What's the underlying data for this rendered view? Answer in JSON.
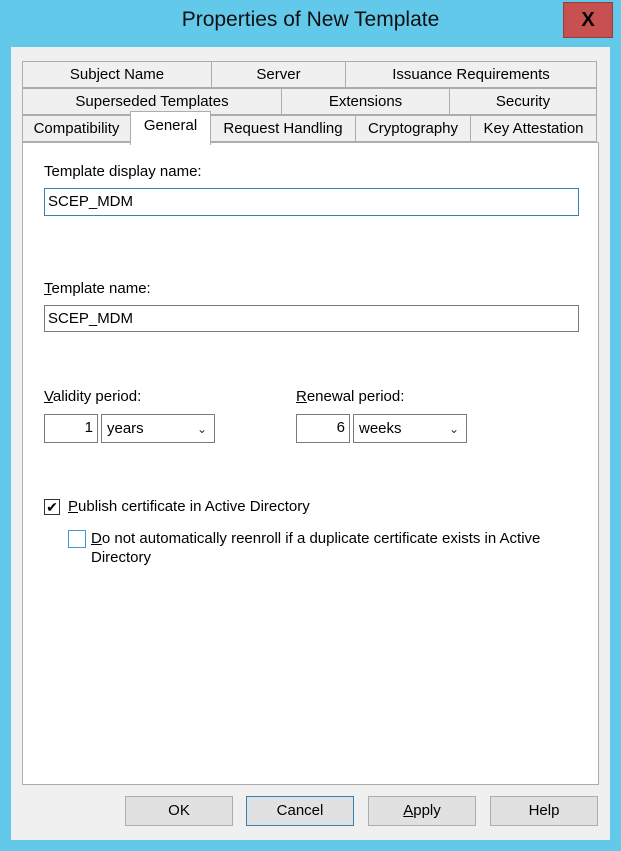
{
  "window": {
    "title": "Properties of New Template",
    "close_label": "X"
  },
  "tabs": {
    "row1": [
      "Subject Name",
      "Server",
      "Issuance Requirements"
    ],
    "row2": [
      "Superseded Templates",
      "Extensions",
      "Security"
    ],
    "row3": [
      "Compatibility",
      "General",
      "Request Handling",
      "Cryptography",
      "Key Attestation"
    ],
    "active": "General"
  },
  "general": {
    "display_name_label": "Template display name:",
    "display_name_value": "SCEP_MDM",
    "template_name_label_first": "T",
    "template_name_label_rest": "emplate name:",
    "template_name_value": "SCEP_MDM",
    "validity_label_first": "V",
    "validity_label_rest": "alidity period:",
    "validity_value": "1",
    "validity_unit": "years",
    "renewal_label_first": "R",
    "renewal_label_rest": "enewal period:",
    "renewal_value": "6",
    "renewal_unit": "weeks",
    "publish_label_first": "P",
    "publish_label_rest": "ublish certificate in Active Directory",
    "publish_checked": true,
    "check_mark": "✔",
    "noreenroll_label_first": "D",
    "noreenroll_label_line1": "o not automatically reenroll if a duplicate certificate exists in Active",
    "noreenroll_label_line2": "Directory",
    "noreenroll_checked": false
  },
  "buttons": {
    "ok": "OK",
    "cancel": "Cancel",
    "apply_first": "A",
    "apply_rest": "pply",
    "help": "Help"
  }
}
